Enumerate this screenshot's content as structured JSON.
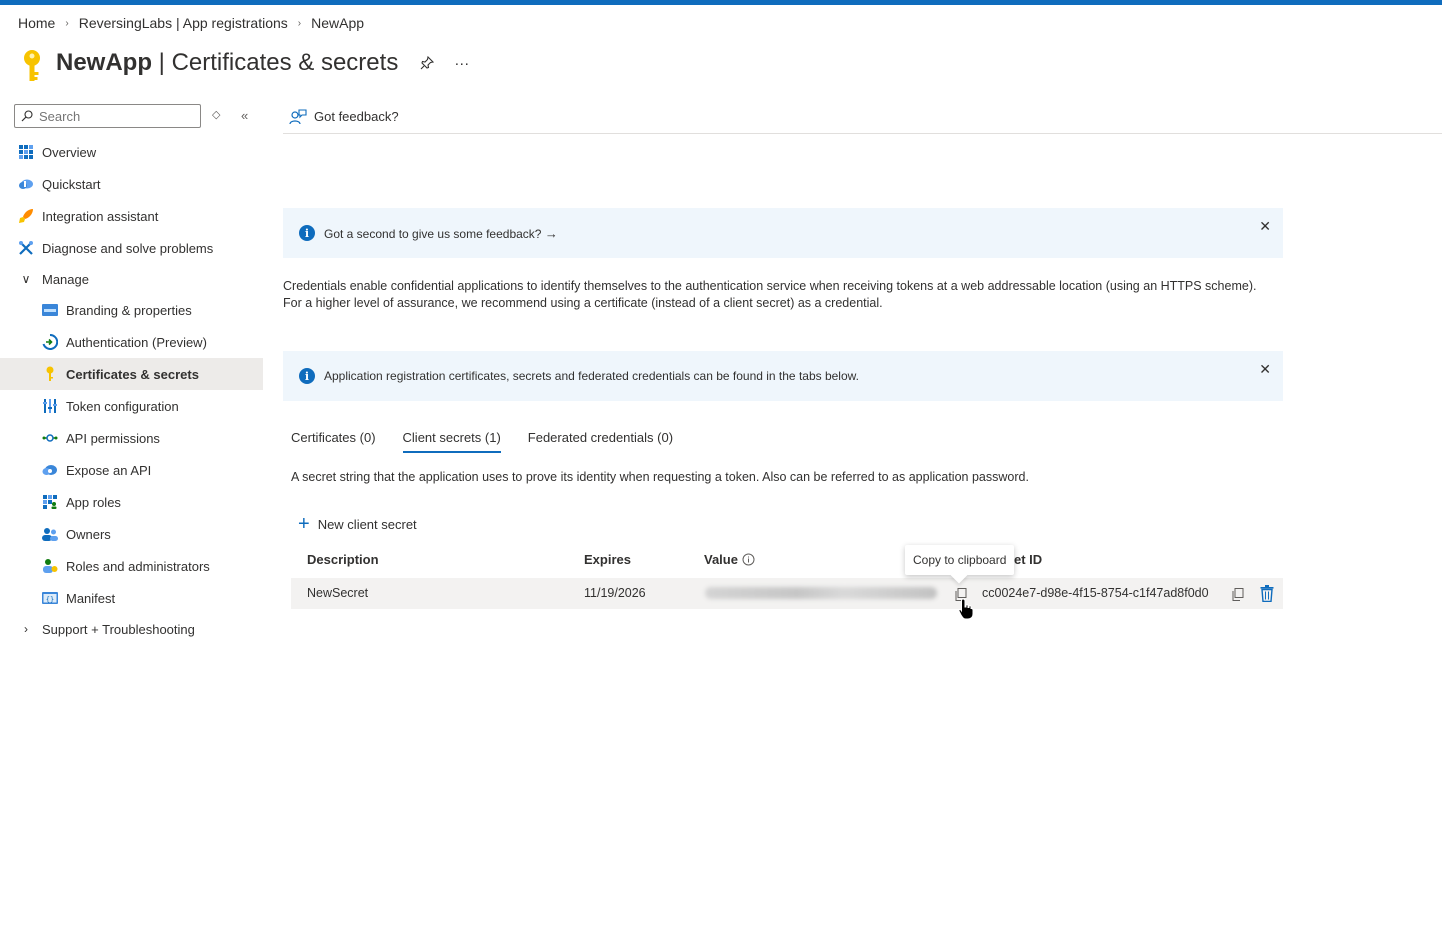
{
  "breadcrumb": [
    "Home",
    "ReversingLabs | App registrations",
    "NewApp"
  ],
  "header": {
    "app_name": "NewApp",
    "page_title": "Certificates & secrets",
    "more": "···"
  },
  "sidebar": {
    "search_placeholder": "Search",
    "items": [
      {
        "label": "Overview",
        "icon": "overview-grid-icon"
      },
      {
        "label": "Quickstart",
        "icon": "quickstart-cloud-icon"
      },
      {
        "label": "Integration assistant",
        "icon": "rocket-icon"
      },
      {
        "label": "Diagnose and solve problems",
        "icon": "wrench-icon"
      }
    ],
    "manage_label": "Manage",
    "manage_items": [
      {
        "label": "Branding & properties",
        "icon": "branding-icon"
      },
      {
        "label": "Authentication (Preview)",
        "icon": "authentication-icon"
      },
      {
        "label": "Certificates & secrets",
        "icon": "key-icon",
        "active": true
      },
      {
        "label": "Token configuration",
        "icon": "token-icon"
      },
      {
        "label": "API permissions",
        "icon": "api-permissions-icon"
      },
      {
        "label": "Expose an API",
        "icon": "cloud-api-icon"
      },
      {
        "label": "App roles",
        "icon": "app-roles-icon"
      },
      {
        "label": "Owners",
        "icon": "owners-icon"
      },
      {
        "label": "Roles and administrators",
        "icon": "roles-icon"
      },
      {
        "label": "Manifest",
        "icon": "manifest-icon"
      }
    ],
    "support_label": "Support + Troubleshooting"
  },
  "command_bar": {
    "feedback_label": "Got feedback?"
  },
  "feedback_banner": {
    "text": "Got a second to give us some feedback?",
    "arrow": "→"
  },
  "description": "Credentials enable confidential applications to identify themselves to the authentication service when receiving tokens at a web addressable location (using an HTTPS scheme). For a higher level of assurance, we recommend using a certificate (instead of a client secret) as a credential.",
  "info_banner": {
    "text": "Application registration certificates, secrets and federated credentials can be found in the tabs below."
  },
  "tabs": [
    "Certificates (0)",
    "Client secrets (1)",
    "Federated credentials (0)"
  ],
  "active_tab": "Client secrets (1)",
  "tab_description": "A secret string that the application uses to prove its identity when requesting a token. Also can be referred to as application password.",
  "new_secret_label": "New client secret",
  "table": {
    "headers": {
      "description": "Description",
      "expires": "Expires",
      "value": "Value",
      "secret_id": "et ID"
    },
    "rows": [
      {
        "description": "NewSecret",
        "expires": "11/19/2026",
        "value": "",
        "secret_id": "cc0024e7-d98e-4f15-8754-c1f47ad8f0d0"
      }
    ]
  },
  "tooltip": "Copy to clipboard",
  "colors": {
    "accent": "#0f6cbd",
    "banner_bg": "#eff6fc",
    "active_bg": "#edebe9",
    "row_bg": "#f3f2f1",
    "key": "#f7c300"
  }
}
